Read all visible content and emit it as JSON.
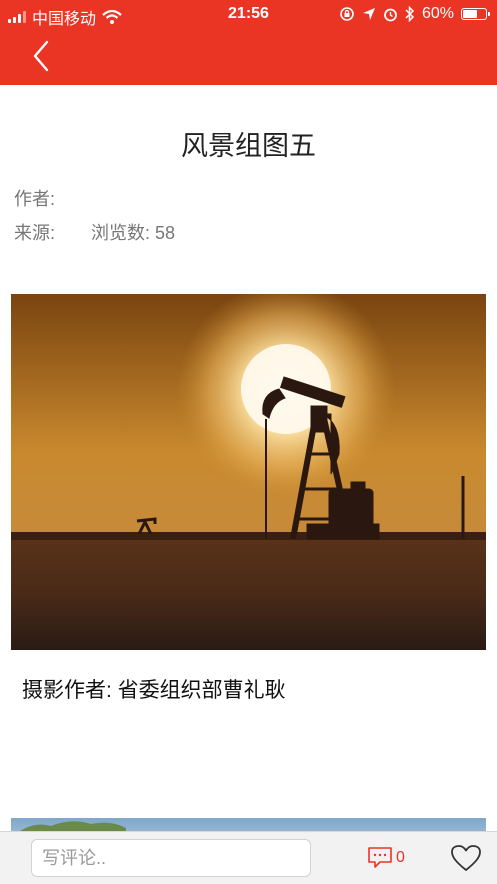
{
  "status_bar": {
    "carrier": "中国移动",
    "time": "21:56",
    "battery": "60%",
    "battery_level": 0.6,
    "icons": [
      "signal-icon",
      "wifi-icon",
      "orientation-lock-icon",
      "location-icon",
      "alarm-icon",
      "bluetooth-icon",
      "battery-icon"
    ]
  },
  "nav": {
    "back_icon": "chevron-left-icon"
  },
  "article": {
    "title": "风景组图五",
    "author_label": "作者:",
    "source_label": "来源:",
    "views_text": "浏览数: 58",
    "caption": "摄影作者: 省委组织部曹礼耿"
  },
  "comment_bar": {
    "input_placeholder": "写评论..",
    "comment_count": "0",
    "comment_icon": "comment-icon",
    "like_icon": "heart-icon"
  },
  "colors": {
    "brand": "#ea3424",
    "bottom_bar": "#f2f2f2"
  }
}
